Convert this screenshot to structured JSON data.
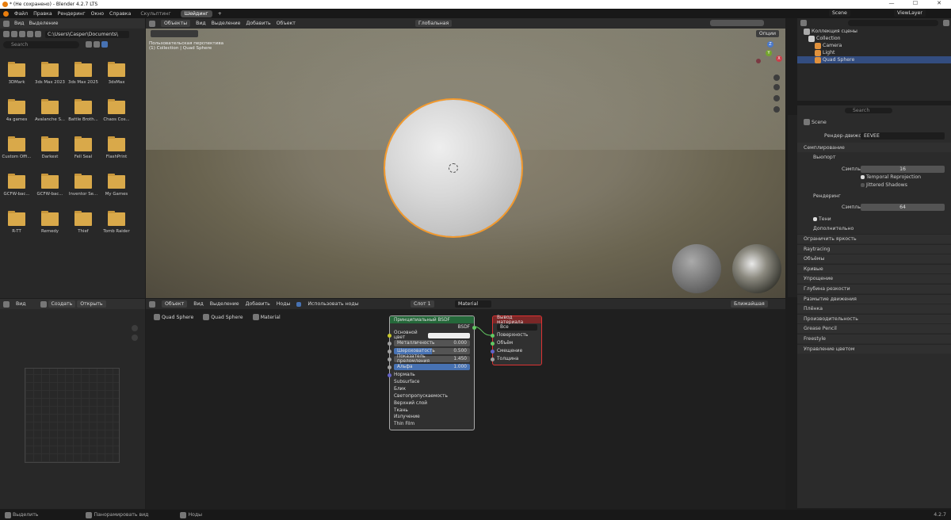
{
  "titlebar": {
    "title": "* (Не сохранено) - Blender 4.2.7 LTS",
    "min": "—",
    "max": "☐",
    "close": "✕"
  },
  "topbar": {
    "menu": [
      "Файл",
      "Правка",
      "Рендеринг",
      "Окно",
      "Справка"
    ],
    "workspaces": [
      "Скульптинг",
      "Шейдинг"
    ],
    "active_workspace": "Шейдинг",
    "add": "+",
    "scene": "Scene",
    "viewlayer": "ViewLayer"
  },
  "filebrowser": {
    "view": "Вид",
    "select": "Выделение",
    "path": "C:\\Users\\Casper\\Documents\\",
    "search_placeholder": "Search",
    "folders": [
      "3DMark",
      "3ds Max 2023",
      "3ds Max 2025",
      "3dsMax",
      "4a games",
      "Avalanche S...",
      "Battle Broth...",
      "Chaos Cos...",
      "Custom Offi...",
      "Darkest",
      "Fell Seal",
      "FlashPrint",
      "GCFW-bac...",
      "GCFW-bac...",
      "Inventor Se...",
      "My Games",
      "R-TT",
      "Remedy",
      "Thief",
      "Tomb Raider"
    ]
  },
  "viewport": {
    "mode": "Объекты",
    "view": "Вид",
    "select": "Выделение",
    "add": "Добавить",
    "object": "Объект",
    "orientation": "Глобальная",
    "options": "Опции",
    "info1": "Пользовательская перспектива",
    "info2": "(1) Collection | Quad Sphere",
    "gizmo": {
      "x": "X",
      "y": "Y",
      "z": "Z"
    }
  },
  "outliner": {
    "root": "Коллекция сцены",
    "search_placeholder": "",
    "items": [
      "Collection",
      "Camera",
      "Light",
      "Quad Sphere"
    ]
  },
  "props": {
    "search_placeholder": "Search",
    "scene": "Scene",
    "engine_label": "Рендер-движок",
    "engine": "EEVEE",
    "sampling": "Семплирование",
    "viewport": "Вьюпорт",
    "samples_label": "Сэмплы",
    "viewport_samples": "16",
    "temporal": "Temporal Reprojection",
    "jittered": "Jittered Shadows",
    "render": "Рендеринг",
    "render_samples_label": "Сэмплы",
    "render_samples": "64",
    "shadows": "Тени",
    "extra": "Дополнительно",
    "panels": [
      "Ограничить яркость",
      "Raytracing",
      "Объёмы",
      "Кривые",
      "Упрощение",
      "Глубина резкости",
      "Размытие движения",
      "Плёнка",
      "Производительность",
      "Grease Pencil",
      "Freestyle",
      "Управление цветом"
    ]
  },
  "nodehdr": {
    "type": "Объект",
    "view": "Вид",
    "select": "Выделение",
    "add": "Добавить",
    "nodes": "Ноды",
    "use_nodes": "Использовать ноды",
    "slot": "Слот 1",
    "material": "Material",
    "interp": "Ближайшая"
  },
  "breadcrumb": [
    "Quad Sphere",
    "Quad Sphere",
    "Material"
  ],
  "bsdf": {
    "title": "Принципиальный BSDF",
    "out": "BSDF",
    "base_color": "Основной цвет",
    "metallic": "Металличность",
    "metallic_v": "0.000",
    "roughness": "Шероховатость",
    "roughness_v": "0.500",
    "ior": "Показатель преломления",
    "ior_v": "1.450",
    "alpha": "Альфа",
    "alpha_v": "1.000",
    "normal": "Нормаль",
    "sections": [
      "Subsurface",
      "Блик",
      "Светопропускаемость",
      "Верхний слой",
      "Ткань",
      "Излучение",
      "Thin Film"
    ]
  },
  "output": {
    "title": "Вывод материала",
    "target": "Все",
    "sockets": [
      "Поверхность",
      "Объём",
      "Смещение",
      "Толщина"
    ]
  },
  "leftbottom": {
    "view": "Вид",
    "create": "Создать",
    "open": "Открыть"
  },
  "status": {
    "select": "Выделить",
    "pan": "Панорамировать вид",
    "nodes": "Ноды",
    "version": "4.2.7"
  }
}
